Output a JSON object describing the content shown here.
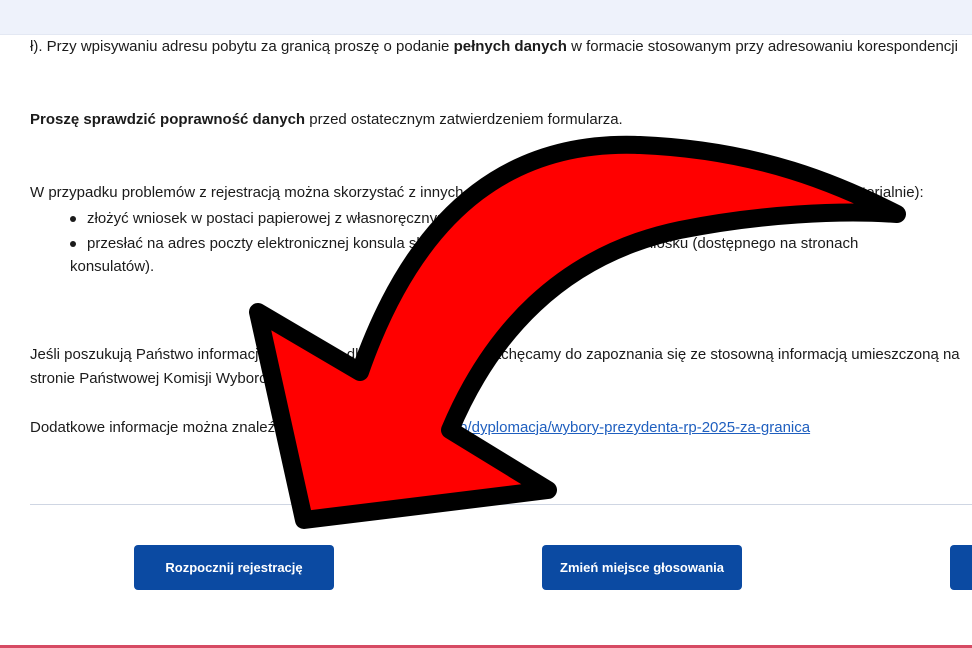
{
  "content": {
    "p1_prefix": "ł). Przy wpisywaniu adresu pobytu za granicą proszę o podanie ",
    "p1_bold": "pełnych danych",
    "p1_suffix": " w formacie stosowanym przy adresowaniu korespondencji",
    "p2_bold": "Proszę sprawdzić poprawność danych",
    "p2_rest": " przed ostatecznym zatwierdzeniem formularza.",
    "p3": "W przypadku problemów z rejestracją można skorzystać z innych sposobów zgłoszenia zamiaru głosowania (właściwego terytorialnie):",
    "bullets": [
      "złożyć wniosek w postaci papierowej z własnoręcznym podpisem (osobiście, pocztą),",
      "przesłać na adres poczty elektronicznej konsula skan podpisanego własnoręcznie wniosku (dostępnego na stronach"
    ],
    "bullet2_cont": "konsulatów).",
    "p4_line1": "Jeśli poszukują Państwo informacji o wyborach dla osób za granicą, zachęcamy do zapoznania się ze stosowną informacją umieszczoną na",
    "p4_line2": "stronie Państwowej Komisji Wyborczej.",
    "p5_prefix": "Dodatkowe informacje można znaleźć na stronie: ",
    "p5_link": "www.gov.pl/web/dyplomacja/wybory-prezydenta-rp-2025-za-granica"
  },
  "buttons": {
    "start": "Rozpocznij rejestrację",
    "change": "Zmień miejsce głosowania",
    "third": ""
  },
  "colors": {
    "button_bg": "#0b4aa2",
    "link": "#1f5fbf",
    "arrow_fill": "#ff0000",
    "arrow_outline": "#000000",
    "bottom_accent": "#d64a63"
  }
}
